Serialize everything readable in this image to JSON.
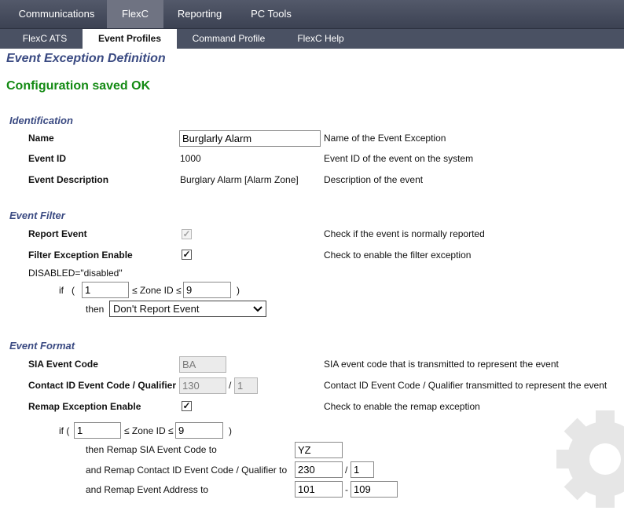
{
  "nav": {
    "tabs": [
      {
        "label": "Communications"
      },
      {
        "label": "FlexC"
      },
      {
        "label": "Reporting"
      },
      {
        "label": "PC Tools"
      }
    ],
    "subtabs": [
      {
        "label": "FlexC ATS"
      },
      {
        "label": "Event Profiles"
      },
      {
        "label": "Command Profile"
      },
      {
        "label": "FlexC Help"
      }
    ]
  },
  "page": {
    "title": "Event Exception Definition",
    "status": "Configuration saved OK"
  },
  "identification": {
    "heading": "Identification",
    "name_label": "Name",
    "name_value": "Burglarly Alarm",
    "name_desc": "Name of the Event Exception",
    "event_id_label": "Event ID",
    "event_id_value": "1000",
    "event_id_desc": "Event ID of the event on the system",
    "event_desc_label": "Event Description",
    "event_desc_value": "Burglary Alarm [Alarm Zone]",
    "event_desc_desc": "Description of the event"
  },
  "event_filter": {
    "heading": "Event Filter",
    "report_label": "Report Event",
    "report_desc": "Check if the event is normally reported",
    "filter_label": "Filter Exception Enable",
    "filter_desc": "Check to enable the filter exception",
    "stray_text": "DISABLED=\"disabled\"",
    "if_text": "if",
    "open_paren": "(",
    "zone_text": "≤ Zone ID ≤",
    "close_paren": ")",
    "zone_from": "1",
    "zone_to": "9",
    "then_text": "then",
    "action_selected": "Don't Report Event"
  },
  "event_format": {
    "heading": "Event Format",
    "sia_label": "SIA Event Code",
    "sia_value": "BA",
    "sia_desc": "SIA event code that is transmitted to represent the event",
    "cid_label": "Contact ID Event Code / Qualifier",
    "cid_code": "130",
    "cid_sep": "/",
    "cid_qualifier": "1",
    "cid_desc": "Contact ID Event Code / Qualifier transmitted to represent the event",
    "remap_label": "Remap Exception Enable",
    "remap_desc": "Check to enable the remap exception",
    "if_text": "if (",
    "zone_text": "≤ Zone ID ≤",
    "close_paren": ")",
    "zone_from": "1",
    "zone_to": "9",
    "remap_sia_label": "then Remap SIA Event Code to",
    "remap_sia_value": "YZ",
    "remap_cid_label": "and Remap Contact ID Event Code / Qualifier to",
    "remap_cid_code": "230",
    "remap_cid_sep": "/",
    "remap_cid_qualifier": "1",
    "remap_addr_label": "and Remap Event Address to",
    "remap_addr_from": "101",
    "remap_addr_sep": "-",
    "remap_addr_to": "109"
  },
  "colors": {
    "nav_bg": "#444a5b",
    "heading": "#3a4a82",
    "status": "#138a13"
  },
  "icons": {
    "checkbox_checked": "check-mark",
    "select_arrow": "chevron-down-icon",
    "background_gear": "gear-icon"
  }
}
